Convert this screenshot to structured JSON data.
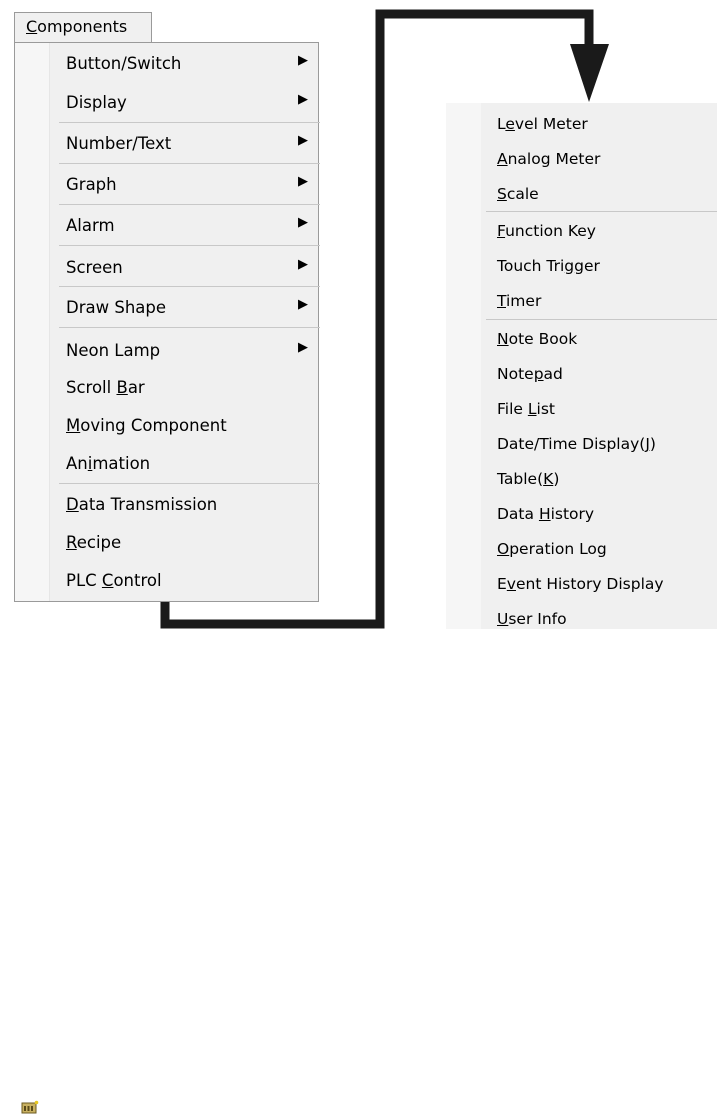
{
  "menubar": {
    "components_label": "Components"
  },
  "components_menu": {
    "items": [
      {
        "label": "Button/Switch",
        "submenu": true
      },
      {
        "label": "Display",
        "submenu": true
      },
      {
        "label": "Number/Text",
        "submenu": true
      },
      {
        "label": "Graph",
        "submenu": true
      },
      {
        "label": "Alarm",
        "submenu": true
      },
      {
        "label": "Screen",
        "submenu": true
      },
      {
        "label": "Draw Shape",
        "submenu": true
      },
      {
        "label": "Neon Lamp",
        "submenu": true
      },
      {
        "label": "Scroll Bar",
        "submenu": false
      },
      {
        "label": "Moving Component",
        "submenu": false
      },
      {
        "label": "Animation",
        "submenu": false
      },
      {
        "label": "Data Transmission",
        "submenu": false
      },
      {
        "label": "Recipe",
        "submenu": false
      },
      {
        "label": "PLC Control",
        "submenu": false,
        "icon": "plc-control-icon"
      }
    ]
  },
  "submenu": {
    "items": [
      {
        "label": "Level Meter"
      },
      {
        "label": "Analog Meter"
      },
      {
        "label": "Scale"
      },
      {
        "label": "Function Key"
      },
      {
        "label": "Touch Trigger"
      },
      {
        "label": "Timer"
      },
      {
        "label": "Note Book"
      },
      {
        "label": "Notepad"
      },
      {
        "label": "File List"
      },
      {
        "label": "Date/Time Display(J)"
      },
      {
        "label": "Table(K)"
      },
      {
        "label": "Data History"
      },
      {
        "label": "Operation Log"
      },
      {
        "label": "Event History Display"
      },
      {
        "label": "User Info"
      }
    ]
  },
  "colors": {
    "menu_bg": "#f0f0f0",
    "separator": "#c8c8c8",
    "arrow": "#1a1a1a"
  }
}
